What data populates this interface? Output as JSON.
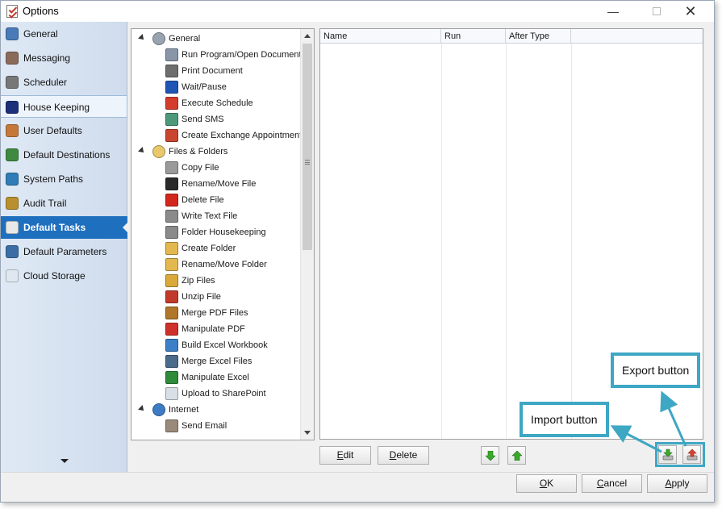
{
  "window": {
    "title": "Options",
    "minimize_glyph": "—",
    "maximize_glyph": "",
    "close_glyph": "✕"
  },
  "sidebar": {
    "items": [
      {
        "label": "General",
        "icon": "general-icon",
        "color": "#4a7ab8"
      },
      {
        "label": "Messaging",
        "icon": "messaging-icon",
        "color": "#8a6b5a"
      },
      {
        "label": "Scheduler",
        "icon": "scheduler-icon",
        "color": "#777777"
      },
      {
        "label": "House Keeping",
        "icon": "house-keeping-icon",
        "color": "#1b2f7a"
      },
      {
        "label": "User Defaults",
        "icon": "user-defaults-icon",
        "color": "#c5783a"
      },
      {
        "label": "Default Destinations",
        "icon": "destinations-icon",
        "color": "#3f8a3f"
      },
      {
        "label": "System Paths",
        "icon": "system-paths-icon",
        "color": "#2f7cb6"
      },
      {
        "label": "Audit Trail",
        "icon": "audit-trail-icon",
        "color": "#b89030"
      },
      {
        "label": "Default Tasks",
        "icon": "default-tasks-icon",
        "color": "#e8e8e8"
      },
      {
        "label": "Default Parameters",
        "icon": "default-parameters-icon",
        "color": "#3b6ea5"
      },
      {
        "label": "Cloud Storage",
        "icon": "cloud-storage-icon",
        "color": "#dfe7f0"
      }
    ],
    "active_index": 8,
    "hover_index": 3
  },
  "tree": {
    "rows": [
      {
        "label": "General",
        "type": "category",
        "icon": "gear-icon",
        "color": "#9aa4b0"
      },
      {
        "label": "Run Program/Open Document",
        "type": "task",
        "icon": "run-program-icon",
        "color": "#8896a8"
      },
      {
        "label": "Print Document",
        "type": "task",
        "icon": "printer-icon",
        "color": "#6e6e6e"
      },
      {
        "label": "Wait/Pause",
        "type": "task",
        "icon": "pause-icon",
        "color": "#1f56b5"
      },
      {
        "label": "Execute Schedule",
        "type": "task",
        "icon": "execute-schedule-icon",
        "color": "#d33b2c"
      },
      {
        "label": "Send SMS",
        "type": "task",
        "icon": "sms-icon",
        "color": "#4c9a7a"
      },
      {
        "label": "Create Exchange Appointment",
        "type": "task",
        "icon": "calendar-icon",
        "color": "#c9452f"
      },
      {
        "label": "Files & Folders",
        "type": "category",
        "icon": "folder-icon",
        "color": "#e8c86a"
      },
      {
        "label": "Copy File",
        "type": "task",
        "icon": "copy-file-icon",
        "color": "#9a9a9a"
      },
      {
        "label": "Rename/Move File",
        "type": "task",
        "icon": "rename-file-icon",
        "color": "#2a2a2a"
      },
      {
        "label": "Delete File",
        "type": "task",
        "icon": "delete-icon",
        "color": "#d3271e"
      },
      {
        "label": "Write Text File",
        "type": "task",
        "icon": "write-text-icon",
        "color": "#8b8b8b"
      },
      {
        "label": "Folder Housekeeping",
        "type": "task",
        "icon": "folder-housekeeping-icon",
        "color": "#8a8a8a"
      },
      {
        "label": "Create Folder",
        "type": "task",
        "icon": "create-folder-icon",
        "color": "#e3b84e"
      },
      {
        "label": "Rename/Move Folder",
        "type": "task",
        "icon": "rename-folder-icon",
        "color": "#e3b84e"
      },
      {
        "label": "Zip Files",
        "type": "task",
        "icon": "zip-icon",
        "color": "#d9a93a"
      },
      {
        "label": "Unzip File",
        "type": "task",
        "icon": "unzip-icon",
        "color": "#c23a2b"
      },
      {
        "label": "Merge PDF Files",
        "type": "task",
        "icon": "merge-pdf-icon",
        "color": "#b0762a"
      },
      {
        "label": "Manipulate PDF",
        "type": "task",
        "icon": "pdf-icon",
        "color": "#d0302a"
      },
      {
        "label": "Build Excel Workbook",
        "type": "task",
        "icon": "excel-workbook-icon",
        "color": "#3a7fc7"
      },
      {
        "label": "Merge Excel Files",
        "type": "task",
        "icon": "merge-excel-icon",
        "color": "#4a6b8a"
      },
      {
        "label": "Manipulate Excel",
        "type": "task",
        "icon": "excel-icon",
        "color": "#2e8b3a"
      },
      {
        "label": "Upload to SharePoint",
        "type": "task",
        "icon": "sharepoint-icon",
        "color": "#d9dfe6"
      },
      {
        "label": "Internet",
        "type": "category",
        "icon": "globe-icon",
        "color": "#3d7cc4"
      },
      {
        "label": "Send Email",
        "type": "task",
        "icon": "email-icon",
        "color": "#9a8a7a"
      }
    ]
  },
  "task_list": {
    "columns": [
      "Name",
      "Run",
      "After Type"
    ]
  },
  "buttons": {
    "edit": {
      "label_prefix": "",
      "label_underline": "E",
      "label_rest": "dit"
    },
    "delete": {
      "label_prefix": "",
      "label_underline": "D",
      "label_rest": "elete"
    },
    "ok": {
      "label_prefix": "",
      "label_underline": "O",
      "label_rest": "K"
    },
    "cancel": {
      "label_prefix": "",
      "label_underline": "C",
      "label_rest": "ancel"
    },
    "apply": {
      "label_prefix": "",
      "label_underline": "A",
      "label_rest": "pply"
    }
  },
  "callouts": {
    "export": "Export button",
    "import": "Import button"
  },
  "colors": {
    "accent": "#1f6fbf",
    "callout": "#3ea7c4",
    "move_arrow": "#3aa82a"
  }
}
